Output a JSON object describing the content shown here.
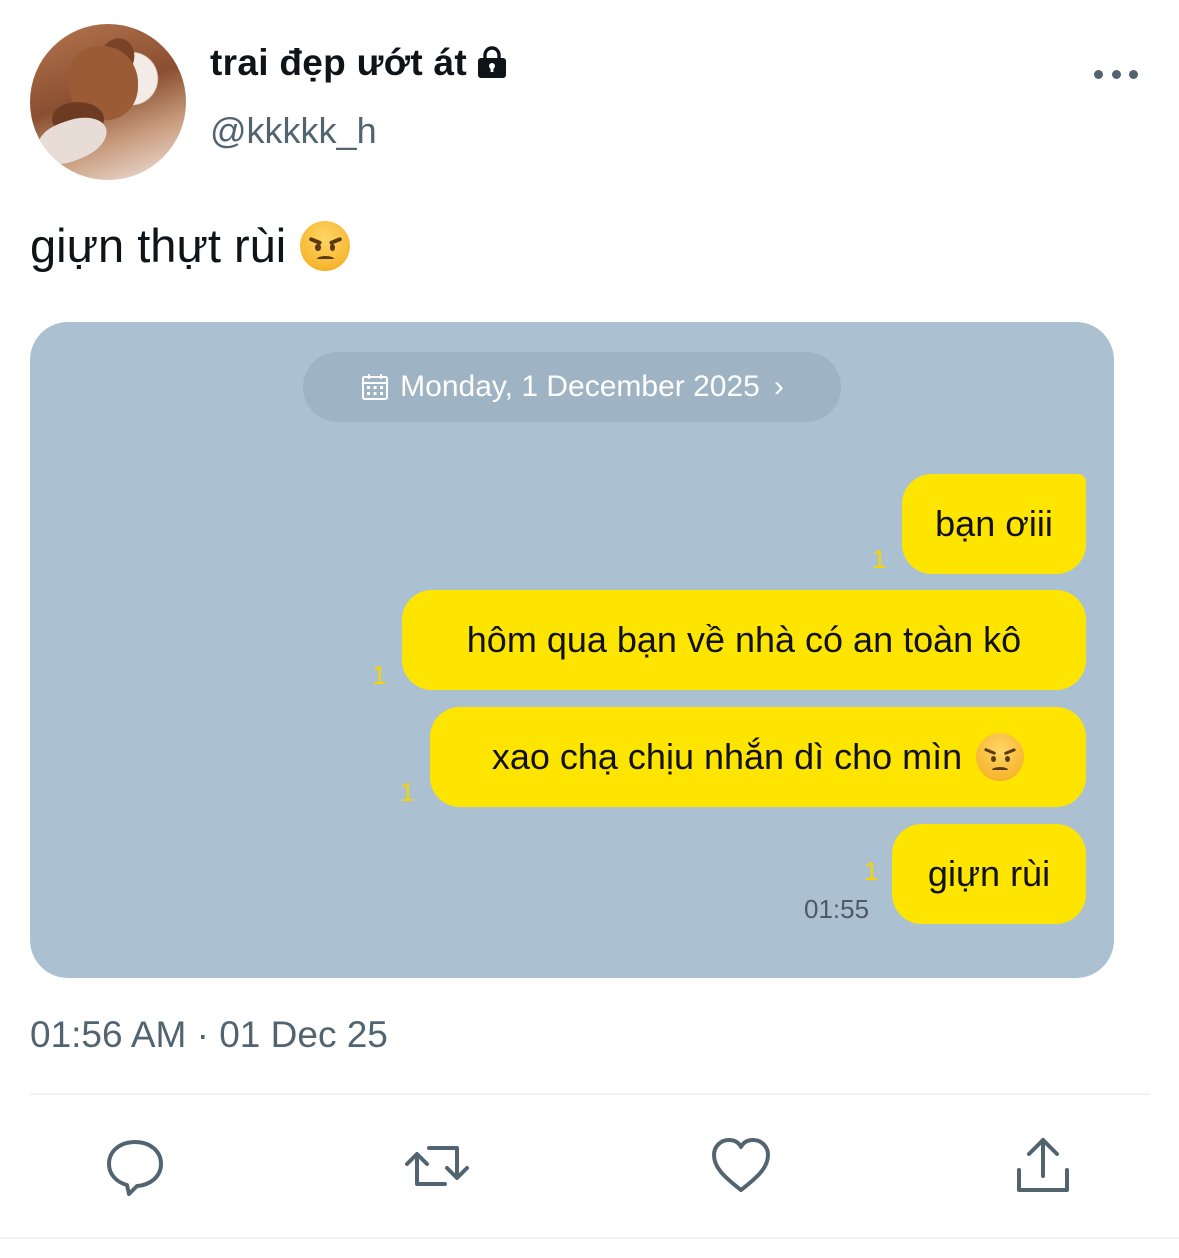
{
  "author": {
    "display_name": "trai đẹp ướt át",
    "handle": "@kkkkk_h",
    "protected_icon": "lock-icon"
  },
  "tweet": {
    "text": "giựn thựt rùi",
    "emoji": "angry-face",
    "timestamp": "01:56 AM · 01 Dec 25"
  },
  "chat_screenshot": {
    "background_color": "#abc1d1",
    "bubble_color": "#fee500",
    "date_label": "Monday, 1 December 2025",
    "date_chevron": "›",
    "messages": [
      {
        "text": "bạn ơiii",
        "read_count": "1"
      },
      {
        "text": "hôm qua bạn về nhà có an toàn kô",
        "read_count": "1"
      },
      {
        "text": "xao chạ chịu nhắn dì cho mìn",
        "read_count": "1",
        "emoji": "angry-face"
      },
      {
        "text": "giựn rùi",
        "read_count": "1",
        "time": "01:55"
      }
    ]
  },
  "actions": [
    {
      "name": "reply",
      "icon": "comment-icon"
    },
    {
      "name": "retweet",
      "icon": "retweet-icon"
    },
    {
      "name": "like",
      "icon": "heart-icon"
    },
    {
      "name": "share",
      "icon": "share-icon"
    }
  ]
}
